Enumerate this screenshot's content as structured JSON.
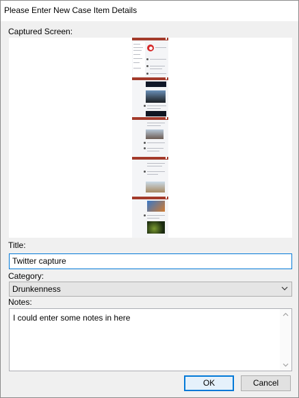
{
  "dialog": {
    "title": "Please Enter New Case Item Details",
    "captured_label": "Captured Screen:",
    "title_label": "Title:",
    "title_value": "Twitter capture",
    "category_label": "Category:",
    "category_value": "Drunkenness",
    "notes_label": "Notes:",
    "notes_value": "I could enter some notes in here",
    "ok_label": "OK",
    "cancel_label": "Cancel"
  },
  "preview": {
    "pages": 5,
    "header_color": "#a33a2a"
  }
}
